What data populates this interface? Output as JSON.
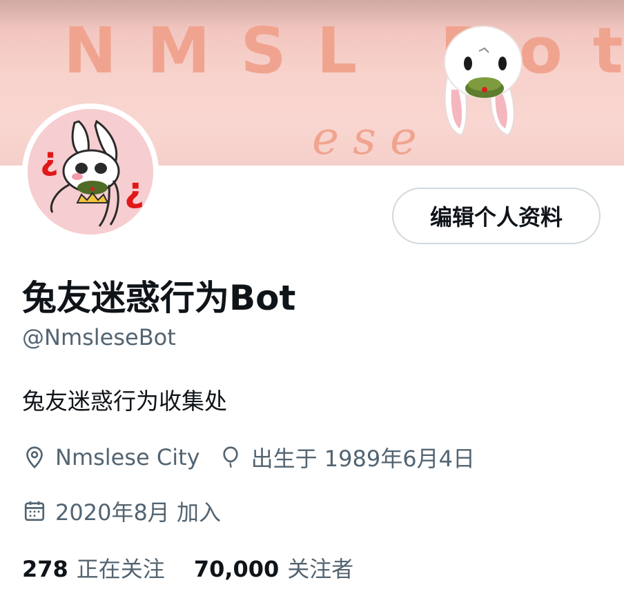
{
  "banner": {
    "title": "NMSL Bot",
    "subtitle": "ese"
  },
  "profile": {
    "edit_button_label": "编辑个人资料",
    "display_name": "兔友迷惑行为Bot",
    "handle": "@NmsleseBot",
    "bio": "兔友迷惑行为收集处",
    "location": "Nmslese City",
    "birthday": "出生于 1989年6月4日",
    "joined": "2020年8月 加入"
  },
  "stats": {
    "following_count": "278",
    "following_label": "正在关注",
    "followers_count": "70,000",
    "followers_label": "关注者"
  },
  "icons": {
    "location": "location-pin-icon",
    "birthday": "balloon-icon",
    "joined": "calendar-icon"
  },
  "colors": {
    "banner_text": "#f0a48f",
    "secondary_text": "#536471",
    "primary_text": "#0f1419",
    "button_border": "#cfd9de"
  }
}
